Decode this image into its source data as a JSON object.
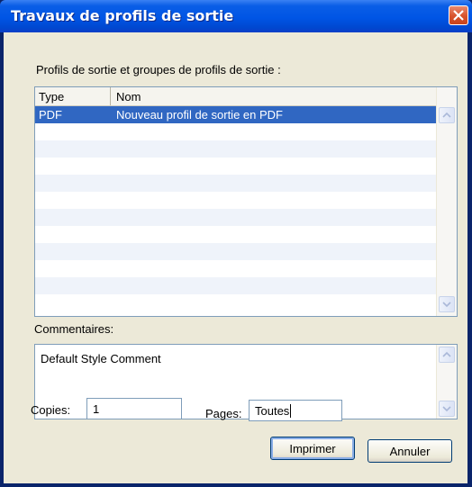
{
  "window": {
    "title": "Travaux de profils de sortie"
  },
  "profiles": {
    "label": "Profils de sortie et groupes de profils de sortie :",
    "columns": [
      "Type",
      "Nom"
    ],
    "rows": [
      {
        "type": "PDF",
        "name": "Nouveau profil de sortie en PDF",
        "selected": true
      }
    ]
  },
  "comments": {
    "label": "Commentaires:",
    "text": "Default Style Comment"
  },
  "copies": {
    "label": "Copies:",
    "value": "1"
  },
  "pages": {
    "label": "Pages:",
    "value": "Toutes"
  },
  "buttons": {
    "print": "Imprimer",
    "cancel": "Annuler"
  },
  "colors": {
    "titlebar": "#0055e5",
    "selection": "#3067c2",
    "dialog_bg": "#ece9d8",
    "close": "#d8532b"
  }
}
